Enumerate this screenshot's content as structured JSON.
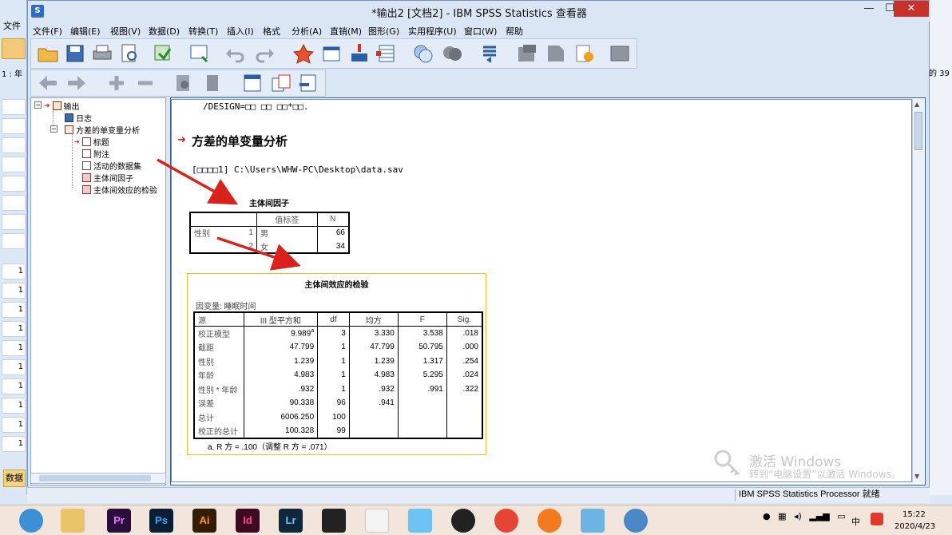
{
  "window": {
    "title": "*输出2 [文档2] - IBM SPSS Statistics 查看器",
    "min": "—",
    "max": "☐",
    "close": "✕"
  },
  "menubar": {
    "items": [
      "文件(F)",
      "编辑(E)",
      "视图(V)",
      "数据(D)",
      "转换(T)",
      "插入(I)",
      "格式",
      "分析(A)",
      "直销(M)",
      "图形(G)",
      "实用程序(U)",
      "窗口(W)",
      "帮助"
    ]
  },
  "background_editor": {
    "menu": "文件",
    "cell_ref": "1 : 年",
    "row_values": [
      "1",
      "1",
      "1",
      "1",
      "1",
      "1",
      "1",
      "1",
      "1",
      "1",
      "1",
      "1",
      "1"
    ],
    "tab": "数据",
    "right_count": "的 39"
  },
  "navigator": {
    "root": "输出",
    "log": "日志",
    "procedure": "方差的单变量分析",
    "children": [
      "标题",
      "附注",
      "活动的数据集",
      "主体间因子",
      "主体间效应的检验"
    ]
  },
  "content": {
    "syntax_line": "/DESIGN=□□ □□ □□*□□.",
    "heading": "方差的单变量分析",
    "dataset_line": "[□□□□1] C:\\Users\\WHW-PC\\Desktop\\data.sav",
    "table1": {
      "title": "主体间因子",
      "headers": [
        "",
        "",
        "值标签",
        "N"
      ],
      "rows": [
        {
          "var": "性别",
          "value": "1",
          "label": "男",
          "n": "66"
        },
        {
          "var": "",
          "value": "2",
          "label": "女",
          "n": "34"
        }
      ]
    },
    "table2": {
      "title": "主体间效应的检验",
      "dependent": "因变量: 睡眠时间",
      "headers": [
        "源",
        "III 型平方和",
        "df",
        "均方",
        "F",
        "Sig."
      ],
      "rows": [
        {
          "source": "校正模型",
          "ss": "9.989",
          "sup": "a",
          "df": "3",
          "ms": "3.330",
          "f": "3.538",
          "sig": ".018"
        },
        {
          "source": "截距",
          "ss": "47.799",
          "sup": "",
          "df": "1",
          "ms": "47.799",
          "f": "50.795",
          "sig": ".000"
        },
        {
          "source": "性别",
          "ss": "1.239",
          "sup": "",
          "df": "1",
          "ms": "1.239",
          "f": "1.317",
          "sig": ".254"
        },
        {
          "source": "年龄",
          "ss": "4.983",
          "sup": "",
          "df": "1",
          "ms": "4.983",
          "f": "5.295",
          "sig": ".024"
        },
        {
          "source": "性别 * 年龄",
          "ss": ".932",
          "sup": "",
          "df": "1",
          "ms": ".932",
          "f": ".991",
          "sig": ".322"
        },
        {
          "source": "误差",
          "ss": "90.338",
          "sup": "",
          "df": "96",
          "ms": ".941",
          "f": "",
          "sig": ""
        },
        {
          "source": "总计",
          "ss": "6006.250",
          "sup": "",
          "df": "100",
          "ms": "",
          "f": "",
          "sig": ""
        },
        {
          "source": "校正的总计",
          "ss": "100.328",
          "sup": "",
          "df": "99",
          "ms": "",
          "f": "",
          "sig": ""
        }
      ],
      "footnote": "a. R 方 = .100（调整 R 方 = .071）"
    }
  },
  "watermark": {
    "line1": "激活 Windows",
    "line2": "转到“电脑设置”以激活 Windows。"
  },
  "statusbar": {
    "text": "IBM SPSS Statistics Processor 就绪"
  },
  "taskbar": {
    "apps": [
      "Pr",
      "Ps",
      "Ai",
      "Id",
      "Lr"
    ],
    "ime": "中",
    "time": "15:22",
    "date": "2020/4/23"
  },
  "colors": {
    "accent_red": "#e0201e",
    "highlight_border": "#e8b92d",
    "window_bg": "#dae6f4"
  }
}
